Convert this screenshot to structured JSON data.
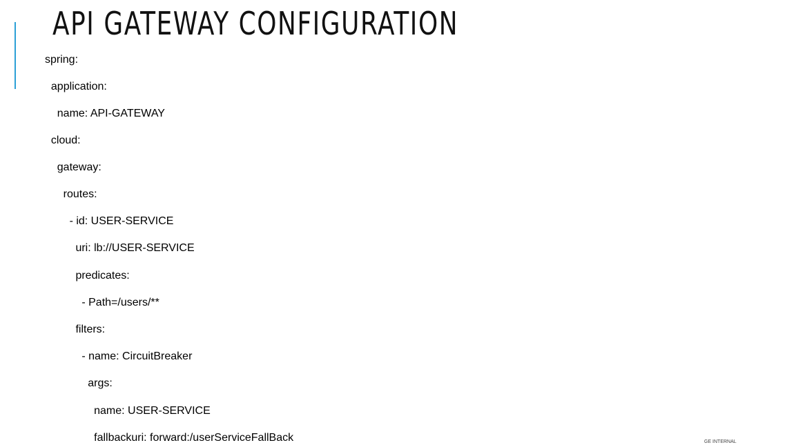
{
  "slide": {
    "title": "API GATEWAY CONFIGURATION",
    "accent_color": "#2a9fd6",
    "code_lines": [
      "spring:",
      "  application:",
      "    name: API-GATEWAY",
      "  cloud:",
      "    gateway:",
      "      routes:",
      "        - id: USER-SERVICE",
      "          uri: lb://USER-SERVICE",
      "          predicates:",
      "            - Path=/users/**",
      "          filters:",
      "            - name: CircuitBreaker",
      "              args:",
      "                name: USER-SERVICE",
      "                fallbackuri: forward:/userServiceFallBack"
    ],
    "footer_label": "GE INTERNAL"
  }
}
